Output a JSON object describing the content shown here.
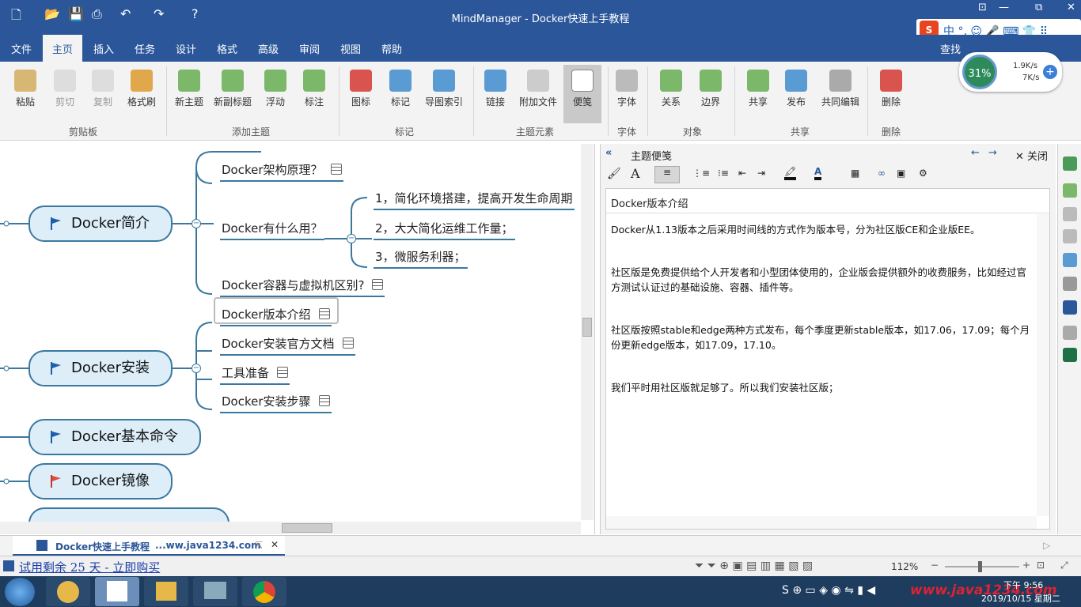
{
  "window": {
    "title": "MindManager - Docker快速上手教程",
    "restore": "⧉",
    "close": "✕"
  },
  "menu": [
    "文件",
    "主页",
    "插入",
    "任务",
    "设计",
    "格式",
    "高级",
    "审阅",
    "视图",
    "帮助"
  ],
  "search_label": "查找",
  "ribbon": {
    "buttons": [
      "粘贴",
      "剪切",
      "复制",
      "格式刷",
      "新主题",
      "新副标题",
      "浮动",
      "标注",
      "图标",
      "标记",
      "导图索引",
      "链接",
      "附加文件",
      "便笺",
      "字体",
      "关系",
      "边界",
      "共享",
      "发布",
      "共同编辑",
      "删除"
    ],
    "groups": [
      "剪贴板",
      "添加主题",
      "标记",
      "主题元素",
      "字体",
      "对象",
      "共享",
      "删除"
    ]
  },
  "net_widget": {
    "percent": "31%",
    "up": "1.9K/s",
    "down": "7K/s"
  },
  "map": {
    "topics": [
      "Docker简介",
      "Docker安装",
      "Docker基本命令",
      "Docker镜像"
    ],
    "sub_intro": [
      "Docker架构原理？",
      "Docker有什么用？",
      "Docker容器与虚拟机区别?"
    ],
    "uses": [
      "1，简化环境搭建，提高开发生命周期",
      "2，大大简化运维工作量；",
      "3，微服务利器；"
    ],
    "sub_install": [
      "Docker版本介绍",
      "Docker安装官方文档",
      "工具准备",
      "Docker安装步骤"
    ]
  },
  "notes": {
    "panel_title": "主题便笺",
    "close_label": "关闭",
    "topic_title": "Docker版本介绍",
    "paragraphs": [
      "Docker从1.13版本之后采用时间线的方式作为版本号，分为社区版CE和企业版EE。",
      "社区版是免费提供给个人开发者和小型团体使用的，企业版会提供额外的收费服务，比如经过官方测试认证过的基础设施、容器、插件等。",
      "社区版按照stable和edge两种方式发布，每个季度更新stable版本，如17.06，17.09；每个月份更新edge版本，如17.09，17.10。",
      "我们平时用社区版就足够了。所以我们安装社区版；"
    ]
  },
  "doc_tab": {
    "name": "Docker快速上手教程",
    "url": "...ww.java1234.com"
  },
  "status": {
    "trial": "试用剩余 25 天 - 立即购买",
    "zoom": "112%"
  },
  "taskbar": {
    "time": "下午 9:56",
    "date": "2019/10/15 星期二",
    "watermark": "www.java1234.com"
  }
}
